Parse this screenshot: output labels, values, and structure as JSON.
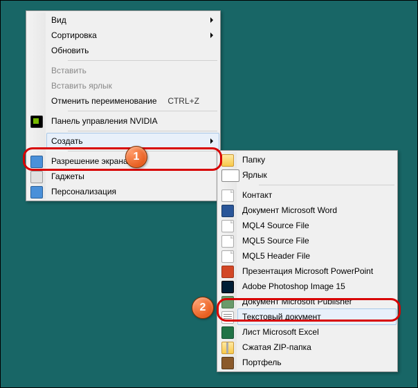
{
  "primary_menu": {
    "view": "Вид",
    "sort": "Сортировка",
    "refresh": "Обновить",
    "paste": "Вставить",
    "paste_shortcut": "Вставить ярлык",
    "undo_rename": "Отменить переименование",
    "undo_shortcut": "CTRL+Z",
    "nvidia": "Панель управления NVIDIA",
    "create": "Создать",
    "resolution": "Разрешение экрана",
    "gadgets": "Гаджеты",
    "personalize": "Персонализация"
  },
  "submenu": {
    "folder": "Папку",
    "shortcut": "Ярлык",
    "contact": "Контакт",
    "word": "Документ Microsoft Word",
    "mql4src": "MQL4 Source File",
    "mql5src": "MQL5 Source File",
    "mql5hdr": "MQL5 Header File",
    "ppt": "Презентация Microsoft PowerPoint",
    "ps": "Adobe Photoshop Image 15",
    "pub": "Документ Microsoft Publisher",
    "text": "Текстовый документ",
    "excel": "Лист Microsoft Excel",
    "zip": "Сжатая ZIP-папка",
    "briefcase": "Портфель"
  },
  "callouts": {
    "one": "1",
    "two": "2"
  }
}
